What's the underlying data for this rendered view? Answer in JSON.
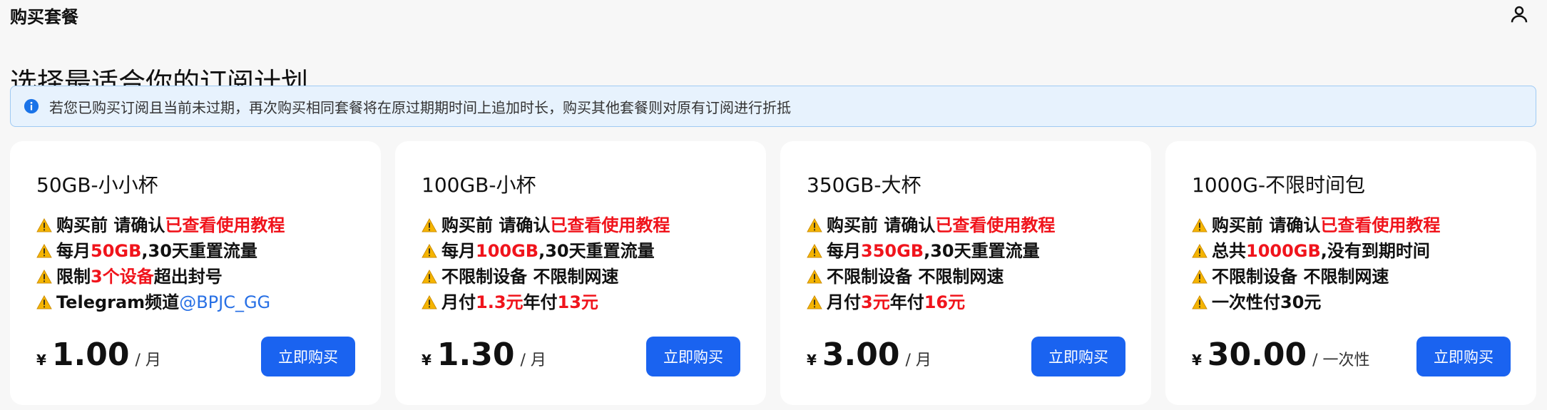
{
  "header": {
    "title": "购买套餐",
    "user_icon": "user-icon"
  },
  "page": {
    "heading": "选择最适合你的订阅计划"
  },
  "notice": {
    "icon": "info-icon",
    "text": "若您已购买订阅且当前未过期，再次购买相同套餐将在原过期期时间上追加时长，购买其他套餐则对原有订阅进行折抵"
  },
  "colors": {
    "accent": "#1a63f0",
    "highlight": "#f0141c",
    "link": "#2870e5",
    "notice_bg": "#e7f2fd"
  },
  "plans": [
    {
      "name": "50GB-小小杯",
      "f1": {
        "a": "购买前 请确认 ",
        "b": "已查看使用教程"
      },
      "f2": {
        "a": "每月 ",
        "b": "50GB",
        "c": ",30天重置流量"
      },
      "f3": {
        "a": "限制 ",
        "b": "3个设备",
        "c": "超出封号"
      },
      "f4": {
        "a": "Telegram频道 ",
        "link": "@BPJC_GG"
      },
      "currency": "¥",
      "price": "1.00",
      "period": "/ 月",
      "button": "立即购买"
    },
    {
      "name": "100GB-小杯",
      "f1": {
        "a": "购买前 请确认 ",
        "b": "已查看使用教程"
      },
      "f2": {
        "a": "每月 ",
        "b": "100GB",
        "c": ",30天重置流量"
      },
      "f3": {
        "a": "不限制设备 不限制网速"
      },
      "f4": {
        "a": "月付",
        "b": "1.3元",
        "c": " 年付",
        "d": "13元"
      },
      "currency": "¥",
      "price": "1.30",
      "period": "/ 月",
      "button": "立即购买"
    },
    {
      "name": "350GB-大杯",
      "f1": {
        "a": "购买前 请确认 ",
        "b": "已查看使用教程"
      },
      "f2": {
        "a": "每月 ",
        "b": "350GB",
        "c": ",30天重置流量"
      },
      "f3": {
        "a": "不限制设备 不限制网速"
      },
      "f4": {
        "a": "月付",
        "b": "3元",
        "c": " 年付",
        "d": "16元"
      },
      "currency": "¥",
      "price": "3.00",
      "period": "/ 月",
      "button": "立即购买"
    },
    {
      "name": "1000G-不限时间包",
      "f1": {
        "a": "购买前 请确认 ",
        "b": "已查看使用教程"
      },
      "f2": {
        "a": "总共 ",
        "b": "1000GB",
        "c": ",没有到期时间"
      },
      "f3": {
        "a": "不限制设备 不限制网速"
      },
      "f4": {
        "a": "一次性付30元"
      },
      "currency": "¥",
      "price": "30.00",
      "period": "/ 一次性",
      "button": "立即购买"
    }
  ]
}
